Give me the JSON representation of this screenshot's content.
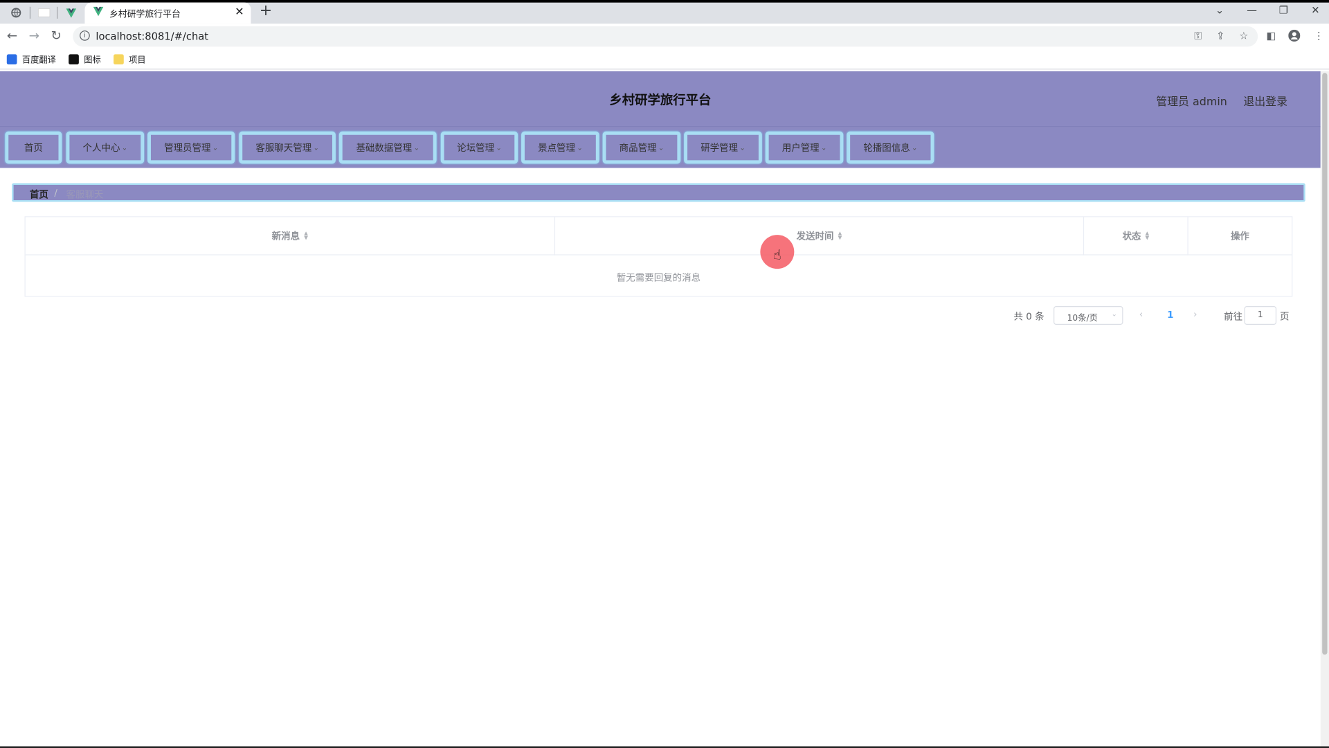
{
  "browser": {
    "tab_title": "乡村研学旅行平台",
    "url": "localhost:8081/#/chat",
    "bookmarks": [
      {
        "label": "百度翻译"
      },
      {
        "label": "图标"
      },
      {
        "label": "项目"
      }
    ]
  },
  "header": {
    "title": "乡村研学旅行平台",
    "user_label": "管理员 admin",
    "logout_label": "退出登录"
  },
  "menu": [
    {
      "label": "首页"
    },
    {
      "label": "个人中心"
    },
    {
      "label": "管理员管理"
    },
    {
      "label": "客服聊天管理"
    },
    {
      "label": "基础数据管理"
    },
    {
      "label": "论坛管理"
    },
    {
      "label": "景点管理"
    },
    {
      "label": "商品管理"
    },
    {
      "label": "研学管理"
    },
    {
      "label": "用户管理"
    },
    {
      "label": "轮播图信息"
    }
  ],
  "breadcrumb": {
    "home": "首页",
    "separator": "/",
    "current": "客服聊天"
  },
  "table": {
    "columns": [
      "新消息",
      "发送时间",
      "状态",
      "操作"
    ],
    "empty_text": "暂无需要回复的消息"
  },
  "pagination": {
    "total_text": "共 0 条",
    "page_size": "10条/页",
    "current_page": "1",
    "goto_label": "前往",
    "goto_value": "1",
    "page_suffix": "页"
  }
}
